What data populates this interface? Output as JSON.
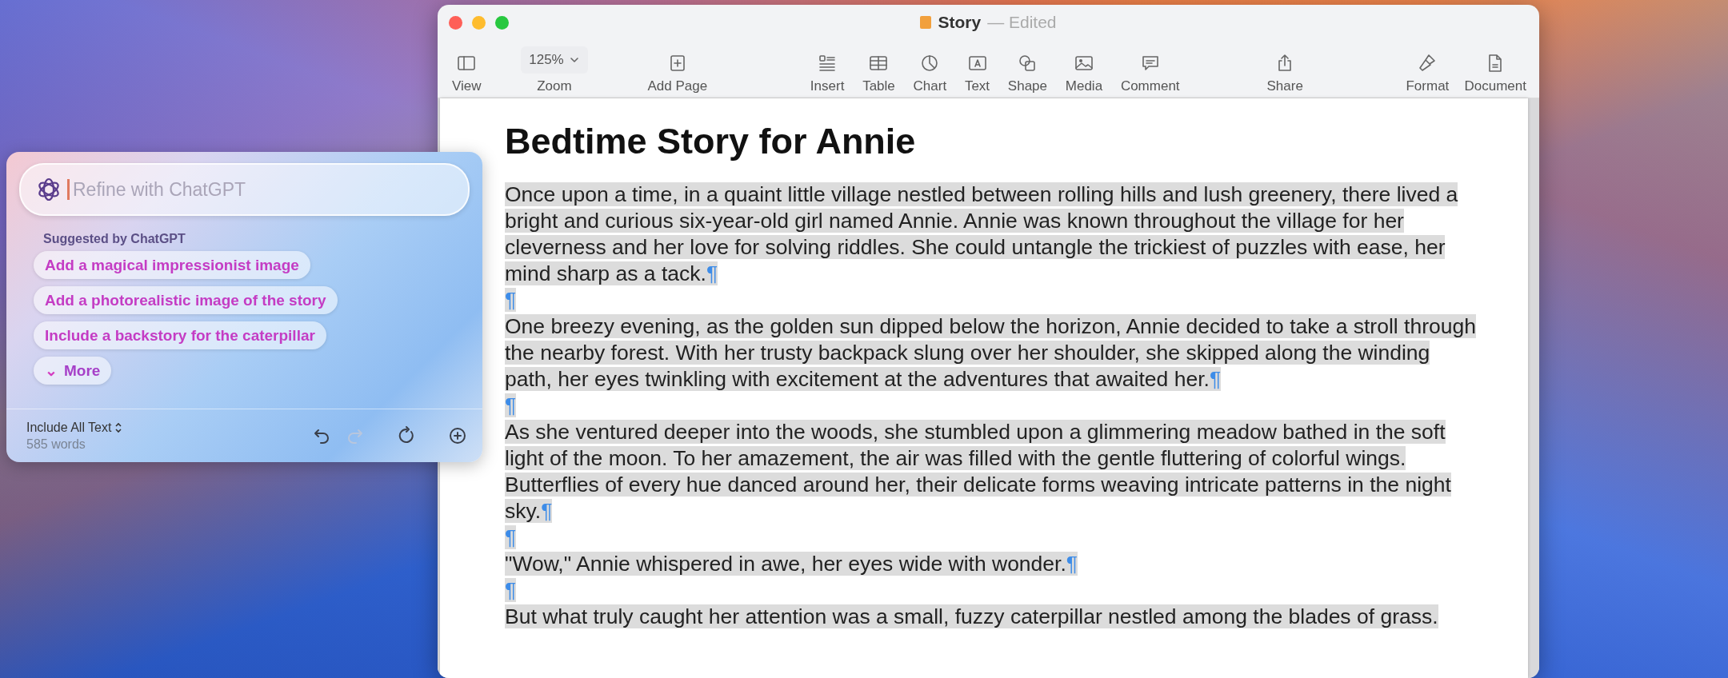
{
  "window": {
    "title": "Story",
    "status": "— Edited"
  },
  "toolbar": [
    {
      "label": "View",
      "kind": "sidebar"
    },
    {
      "label": "Zoom",
      "kind": "zoom",
      "value": "125%"
    },
    {
      "label": "Add Page",
      "kind": "addpage"
    },
    {
      "label": "Insert",
      "kind": "insert"
    },
    {
      "label": "Table",
      "kind": "table"
    },
    {
      "label": "Chart",
      "kind": "chart"
    },
    {
      "label": "Text",
      "kind": "text"
    },
    {
      "label": "Shape",
      "kind": "shape"
    },
    {
      "label": "Media",
      "kind": "media"
    },
    {
      "label": "Comment",
      "kind": "comment"
    },
    {
      "label": "Share",
      "kind": "share"
    },
    {
      "label": "Format",
      "kind": "format"
    },
    {
      "label": "Document",
      "kind": "document"
    }
  ],
  "document": {
    "title": "Bedtime Story for Annie",
    "paragraphs": [
      {
        "text": "Once upon a time, in a quaint little village nestled between rolling hills and lush greenery, there lived a bright and curious six-year-old girl named Annie. Annie was known throughout the village for her cleverness and her love for solving riddles. She could untangle the trickiest of puzzles with ease, her mind sharp as a tack.",
        "mark": "¶",
        "selected": true
      },
      {
        "mark": "¶",
        "selected": true
      },
      {
        "text": "One breezy evening, as the golden sun dipped below the horizon, Annie decided to take a stroll through the nearby forest. With her trusty backpack slung over her shoulder, she skipped along the winding path, her eyes twinkling with excitement at the adventures that awaited her.",
        "mark": "¶",
        "selected": true
      },
      {
        "mark": "¶",
        "selected": true
      },
      {
        "text": "As she ventured deeper into the woods, she stumbled upon a glimmering meadow bathed in the soft light of the moon. To her amazement, the air was filled with the gentle fluttering of colorful wings. Butterflies of every hue danced around her, their delicate forms weaving intricate patterns in the night sky.",
        "mark": "¶",
        "selected": true
      },
      {
        "mark": "¶",
        "selected": true
      },
      {
        "text": "\"Wow,\" Annie whispered in awe, her eyes wide with wonder.",
        "mark": "¶",
        "selected": true
      },
      {
        "mark": "¶",
        "selected": true
      },
      {
        "text": "But what truly caught her attention was a small, fuzzy caterpillar nestled among the blades of grass.",
        "selected": true
      }
    ]
  },
  "assistant": {
    "placeholder": "Refine with ChatGPT",
    "section_label": "Suggested by ChatGPT",
    "suggestions": [
      "Add a magical impressionist image",
      "Add a photorealistic image of the story",
      "Include a backstory for the caterpillar"
    ],
    "more": {
      "icon": "⌄",
      "label": "More"
    },
    "scope": "Include All Text",
    "word_count": "585 words",
    "actions": [
      {
        "kind": "undo",
        "disabled": false
      },
      {
        "kind": "redo",
        "disabled": true
      },
      {
        "kind": "regenerate",
        "disabled": false
      },
      {
        "kind": "add",
        "disabled": false
      }
    ]
  }
}
